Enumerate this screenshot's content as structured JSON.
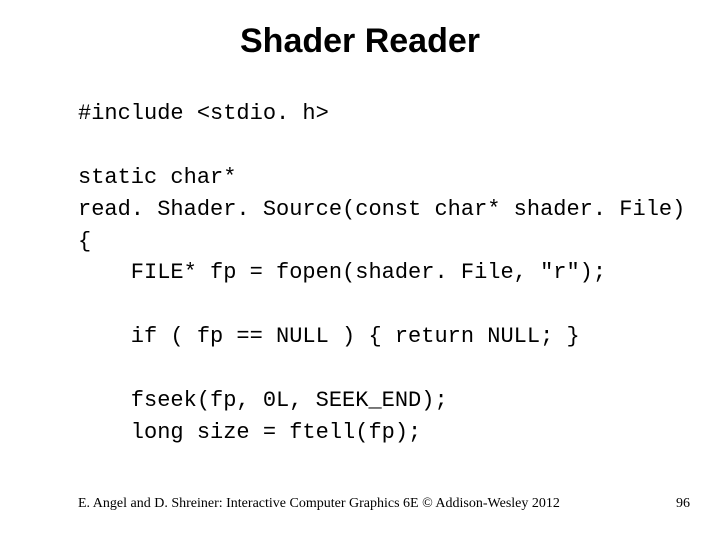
{
  "title": "Shader Reader",
  "code": "#include <stdio. h>\n\nstatic char*\nread. Shader. Source(const char* shader. File)\n{\n    FILE* fp = fopen(shader. File, \"r\");\n\n    if ( fp == NULL ) { return NULL; }\n\n    fseek(fp, 0L, SEEK_END);\n    long size = ftell(fp);",
  "footer": {
    "citation": "E. Angel and D. Shreiner: Interactive Computer Graphics 6E © Addison-Wesley 2012",
    "page_number": "96"
  }
}
